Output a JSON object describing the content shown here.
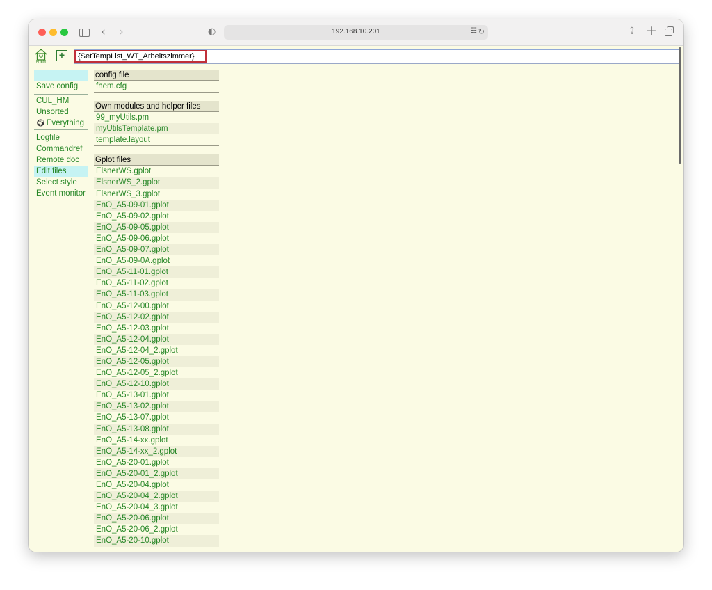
{
  "browser": {
    "url": "192.168.10.201"
  },
  "toolbar": {
    "logo_text": "FHEM",
    "add_label": "+",
    "command_value": "{SetTempList_WT_Arbeitszimmer}"
  },
  "menu": {
    "items": [
      {
        "label": "Save config"
      },
      {
        "label": "CUL_HM"
      },
      {
        "label": "Unsorted"
      },
      {
        "label": "Everything"
      },
      {
        "label": "Logfile"
      },
      {
        "label": "Commandref"
      },
      {
        "label": "Remote doc"
      },
      {
        "label": "Edit files"
      },
      {
        "label": "Select style"
      },
      {
        "label": "Event monitor"
      }
    ]
  },
  "files": {
    "config": {
      "heading": "config file",
      "items": [
        "fhem.cfg"
      ]
    },
    "modules": {
      "heading": "Own modules and helper files",
      "items": [
        "99_myUtils.pm",
        "myUtilsTemplate.pm",
        "template.layout"
      ]
    },
    "gplot": {
      "heading": "Gplot files",
      "items": [
        "ElsnerWS.gplot",
        "ElsnerWS_2.gplot",
        "ElsnerWS_3.gplot",
        "EnO_A5-09-01.gplot",
        "EnO_A5-09-02.gplot",
        "EnO_A5-09-05.gplot",
        "EnO_A5-09-06.gplot",
        "EnO_A5-09-07.gplot",
        "EnO_A5-09-0A.gplot",
        "EnO_A5-11-01.gplot",
        "EnO_A5-11-02.gplot",
        "EnO_A5-11-03.gplot",
        "EnO_A5-12-00.gplot",
        "EnO_A5-12-02.gplot",
        "EnO_A5-12-03.gplot",
        "EnO_A5-12-04.gplot",
        "EnO_A5-12-04_2.gplot",
        "EnO_A5-12-05.gplot",
        "EnO_A5-12-05_2.gplot",
        "EnO_A5-12-10.gplot",
        "EnO_A5-13-01.gplot",
        "EnO_A5-13-02.gplot",
        "EnO_A5-13-07.gplot",
        "EnO_A5-13-08.gplot",
        "EnO_A5-14-xx.gplot",
        "EnO_A5-14-xx_2.gplot",
        "EnO_A5-20-01.gplot",
        "EnO_A5-20-01_2.gplot",
        "EnO_A5-20-04.gplot",
        "EnO_A5-20-04_2.gplot",
        "EnO_A5-20-04_3.gplot",
        "EnO_A5-20-06.gplot",
        "EnO_A5-20-06_2.gplot",
        "EnO_A5-20-10.gplot"
      ]
    }
  }
}
